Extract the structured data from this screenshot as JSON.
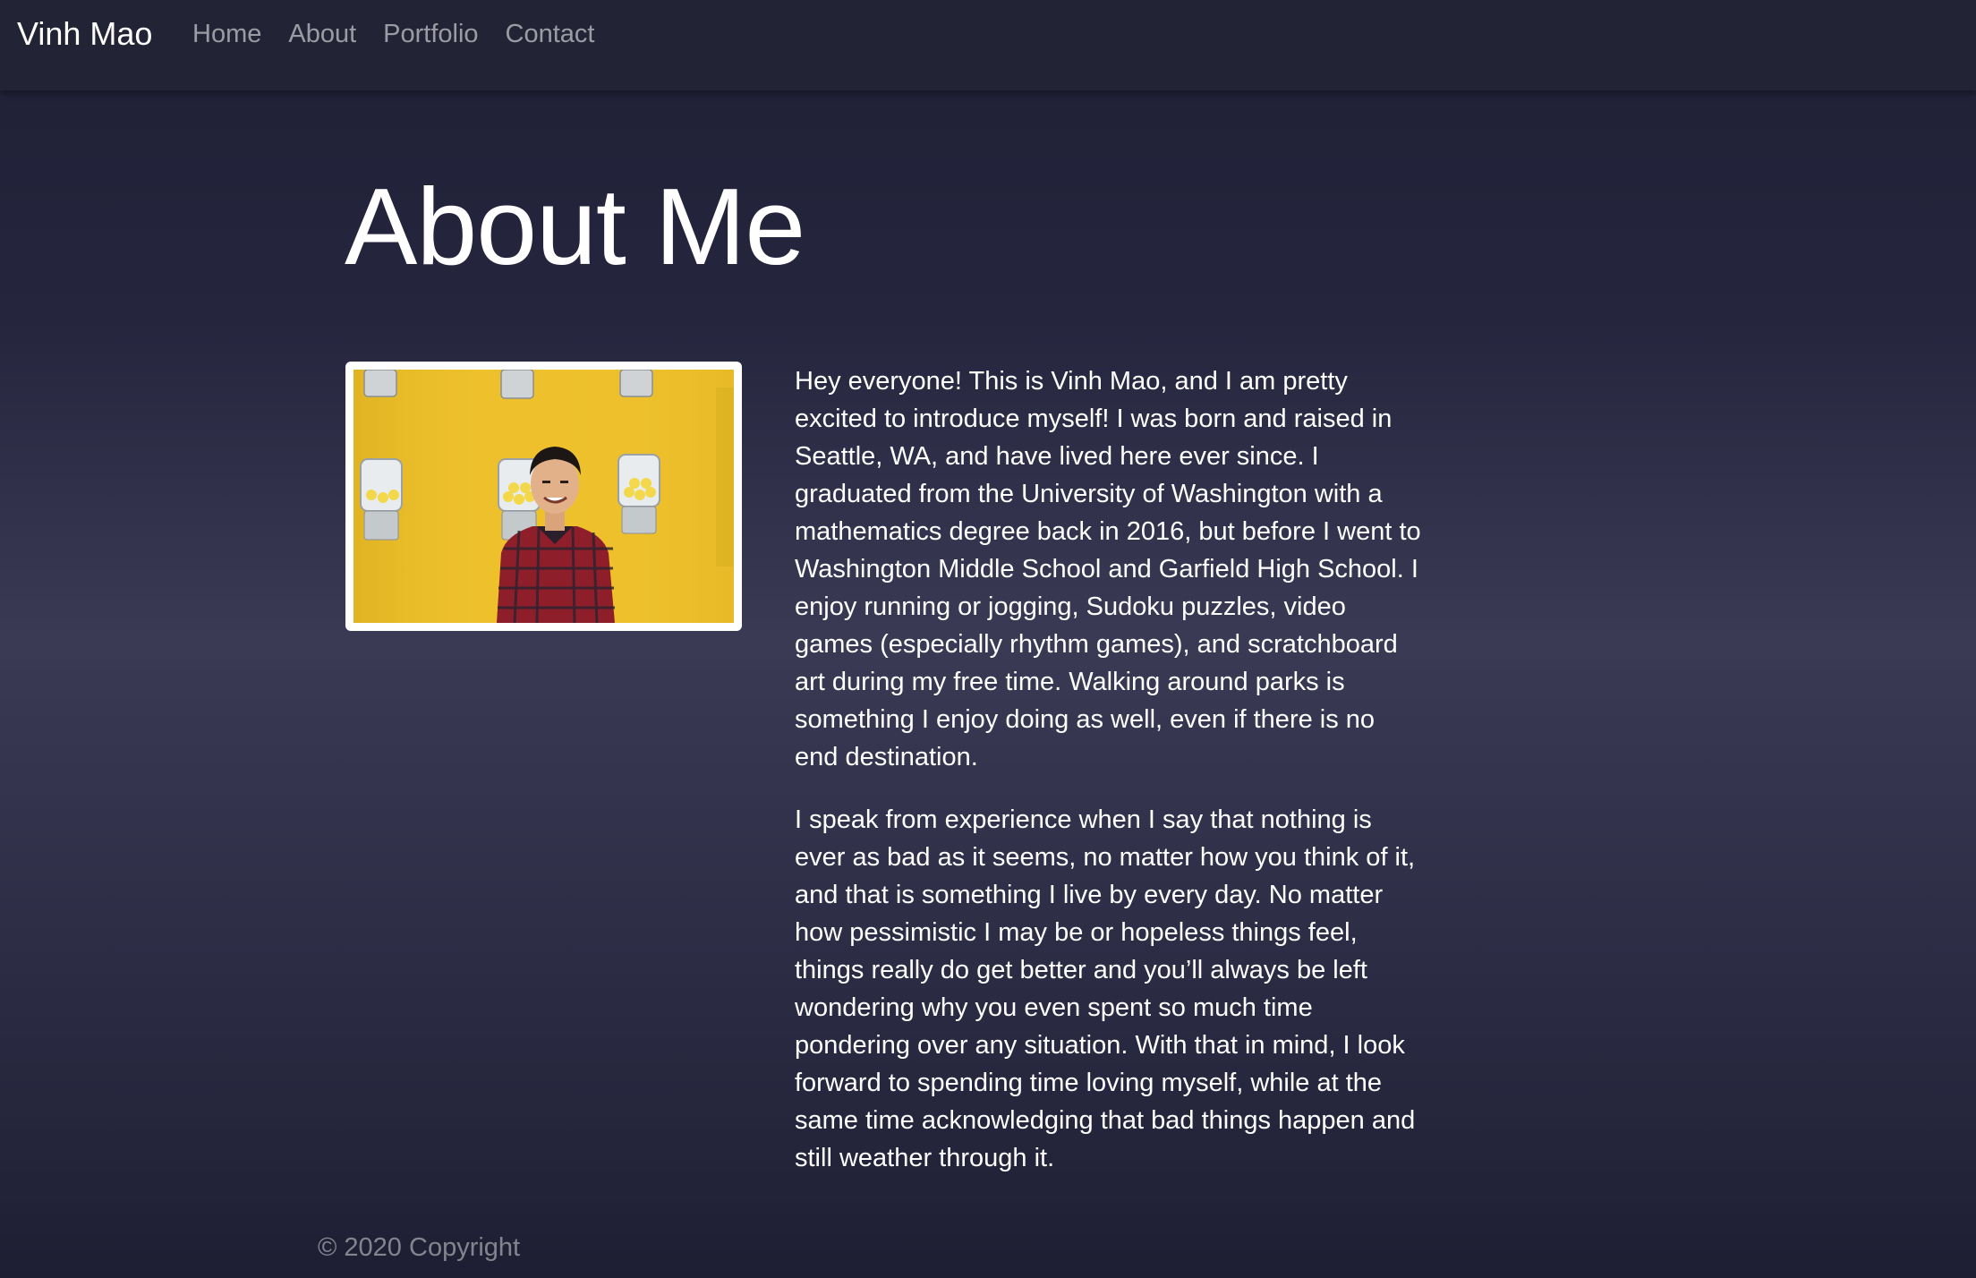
{
  "nav": {
    "brand": "Vinh Mao",
    "links": [
      "Home",
      "About",
      "Portfolio",
      "Contact"
    ]
  },
  "main": {
    "title": "About Me",
    "paragraphs": [
      "Hey everyone! This is Vinh Mao, and I am pretty excited to introduce myself! I was born and raised in Seattle, WA, and have lived here ever since. I graduated from the University of Washington with a mathematics degree back in 2016, but before I went to Washington Middle School and Garfield High School. I enjoy running or jogging, Sudoku puzzles, video games (especially rhythm games), and scratchboard art during my free time. Walking around parks is something I enjoy doing as well, even if there is no end destination.",
      "I speak from experience when I say that nothing is ever as bad as it seems, no matter how you think of it, and that is something I live by every day. No matter how pessimistic I may be or hopeless things feel, things really do get better and you’ll always be left wondering why you even spent so much time pondering over any situation. With that in mind, I look forward to spending time loving myself, while at the same time acknowledging that bad things happen and still weather through it."
    ]
  },
  "footer": {
    "copyright": "© 2020 Copyright"
  },
  "colors": {
    "navbar_bg": "#232336",
    "page_bg": "#2c2c45",
    "photo_bg": "#f0c52a"
  }
}
